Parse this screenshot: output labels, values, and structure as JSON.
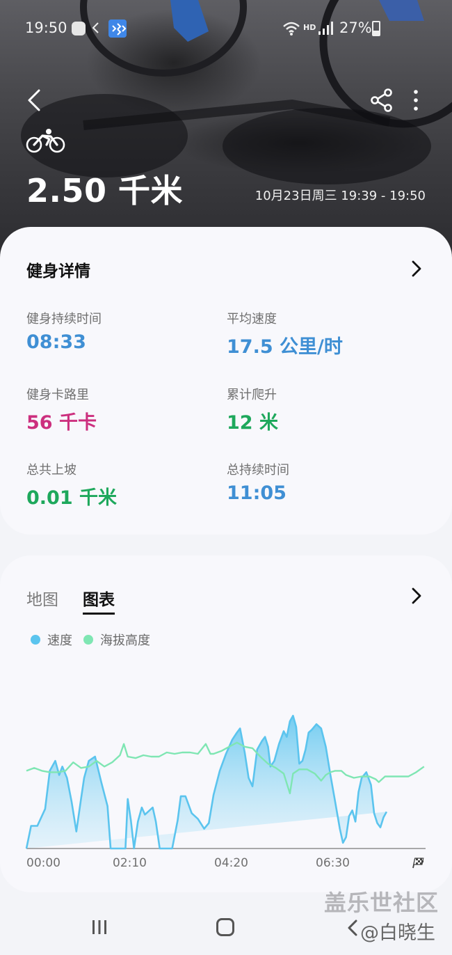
{
  "status_bar": {
    "time": "19:50",
    "battery": "27%",
    "network": "HD"
  },
  "header": {
    "distance": "2.50 千米",
    "datetime": "10月23日周三 19:39 - 19:50"
  },
  "details_card": {
    "title": "健身详情",
    "stats": [
      {
        "label": "健身持续时间",
        "value": "08:33",
        "color": "#3f8fd4"
      },
      {
        "label": "平均速度",
        "value": "17.5 公里/时",
        "color": "#3f8fd4"
      },
      {
        "label": "健身卡路里",
        "value": "56 千卡",
        "color": "#cc2f7e"
      },
      {
        "label": "累计爬升",
        "value": "12 米",
        "color": "#1ea85c"
      },
      {
        "label": "总共上坡",
        "value": "0.01 千米",
        "color": "#1ea85c"
      },
      {
        "label": "总持续时间",
        "value": "11:05",
        "color": "#3f8fd4"
      }
    ]
  },
  "chart_card": {
    "tabs": [
      {
        "label": "地图",
        "active": false
      },
      {
        "label": "图表",
        "active": true
      }
    ],
    "legend": [
      {
        "label": "速度",
        "color": "#5bc4ee"
      },
      {
        "label": "海拔高度",
        "color": "#7fe6b3"
      }
    ]
  },
  "chart_data": {
    "type": "area",
    "x_ticks": [
      "00:00",
      "02:10",
      "04:20",
      "06:30"
    ],
    "xlim_seconds": [
      0,
      512
    ],
    "series": [
      {
        "name": "速度",
        "color": "#5bc4ee",
        "fill": true,
        "t": [
          0,
          6,
          14,
          24,
          30,
          37,
          42,
          46,
          52,
          58,
          64,
          70,
          74,
          80,
          88,
          96,
          104,
          108,
          116,
          122,
          127,
          130,
          134,
          138,
          143,
          148,
          152,
          158,
          162,
          166,
          171,
          176,
          182,
          187,
          194,
          198,
          204,
          212,
          220,
          228,
          234,
          240,
          248,
          256,
          264,
          270,
          274,
          280,
          285,
          290,
          296,
          302,
          306,
          310,
          313,
          318,
          324,
          330,
          334,
          338,
          342,
          346,
          350,
          354,
          358,
          362,
          366,
          372,
          378,
          384,
          390,
          396,
          402,
          406,
          410,
          414,
          418,
          422,
          426,
          430,
          436,
          442,
          446,
          450,
          454,
          458,
          462,
          468,
          474,
          478,
          482,
          486,
          490,
          494,
          498,
          504,
          510
        ],
        "v": [
          0.0,
          0.16,
          0.16,
          0.28,
          0.55,
          0.62,
          0.52,
          0.58,
          0.5,
          0.33,
          0.12,
          0.35,
          0.5,
          0.62,
          0.65,
          0.47,
          0.3,
          0.0,
          0.0,
          0.0,
          0.0,
          0.35,
          0.2,
          0.0,
          0.19,
          0.29,
          0.24,
          0.27,
          0.29,
          0.19,
          0.0,
          0.0,
          0.0,
          0.0,
          0.2,
          0.37,
          0.37,
          0.25,
          0.21,
          0.14,
          0.18,
          0.38,
          0.55,
          0.67,
          0.77,
          0.82,
          0.85,
          0.68,
          0.5,
          0.44,
          0.7,
          0.76,
          0.79,
          0.72,
          0.58,
          0.62,
          0.74,
          0.83,
          0.79,
          0.9,
          0.94,
          0.86,
          0.6,
          0.62,
          0.7,
          0.82,
          0.84,
          0.88,
          0.85,
          0.72,
          0.52,
          0.33,
          0.14,
          0.04,
          0.08,
          0.23,
          0.27,
          0.19,
          0.4,
          0.5,
          0.54,
          0.45,
          0.25,
          0.18,
          0.15,
          0.22,
          0.26
        ],
        "v_scale": "relative (0 = baseline, 1 = chart top)"
      },
      {
        "name": "海拔高度",
        "color": "#7fe6b3",
        "fill": false,
        "t": [
          0,
          10,
          20,
          30,
          40,
          50,
          60,
          70,
          80,
          90,
          100,
          110,
          120,
          125,
          130,
          140,
          150,
          160,
          170,
          180,
          190,
          200,
          210,
          220,
          230,
          236,
          240,
          250,
          260,
          270,
          280,
          290,
          300,
          310,
          320,
          330,
          338,
          342,
          350,
          356,
          360,
          370,
          378,
          384,
          390,
          396,
          404,
          410,
          420,
          430,
          440,
          448,
          452,
          460,
          470,
          480,
          490,
          500,
          510
        ],
        "v": [
          0.55,
          0.57,
          0.55,
          0.54,
          0.54,
          0.55,
          0.61,
          0.57,
          0.58,
          0.62,
          0.58,
          0.61,
          0.66,
          0.74,
          0.65,
          0.64,
          0.66,
          0.65,
          0.65,
          0.68,
          0.67,
          0.68,
          0.68,
          0.67,
          0.74,
          0.67,
          0.67,
          0.69,
          0.72,
          0.75,
          0.72,
          0.71,
          0.65,
          0.6,
          0.57,
          0.53,
          0.39,
          0.53,
          0.56,
          0.56,
          0.56,
          0.53,
          0.48,
          0.52,
          0.54,
          0.55,
          0.55,
          0.52,
          0.5,
          0.51,
          0.51,
          0.49,
          0.47,
          0.51,
          0.51,
          0.51,
          0.51,
          0.54,
          0.58
        ],
        "v_scale": "relative (0 = baseline, 1 = chart top)"
      }
    ],
    "grid": false,
    "legend_position": "top-left"
  },
  "nav": {
    "recent_icon": "recent-apps-icon",
    "home_icon": "home-icon",
    "back_icon": "back-icon"
  },
  "watermark": {
    "line1": "盖乐世社区",
    "line2": "@白晓生"
  }
}
